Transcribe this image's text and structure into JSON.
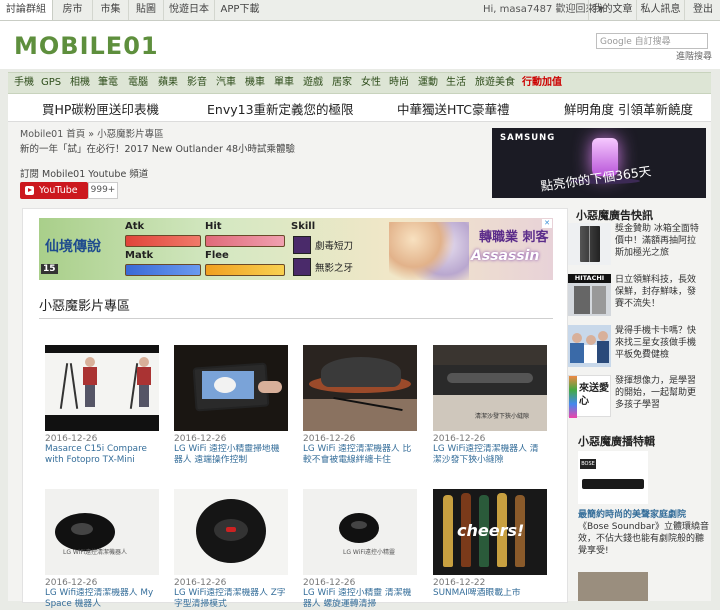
{
  "topbar": {
    "tabs": [
      "討論群組",
      "房市",
      "市集",
      "貼圖",
      "悅遊日本",
      "APP下載"
    ],
    "user_text": "Hi, masa7487 歡迎回來 ▾",
    "links": [
      "我的文章",
      "私人訊息",
      "登出"
    ]
  },
  "header": {
    "logo_text": "MOBILE",
    "logo_num": "01",
    "search_placeholder": "Google 自訂搜尋",
    "search_link": "進階搜尋"
  },
  "nav": {
    "items": [
      "手機",
      "GPS",
      "相機",
      "筆電",
      "電腦",
      "蘋果",
      "影音",
      "汽車",
      "機車",
      "單車",
      "遊戲",
      "居家",
      "女性",
      "時尚",
      "運動",
      "生活",
      "旅遊美食"
    ],
    "hot": "行動加值"
  },
  "promo": {
    "items": [
      "買HP碳粉匣送印表機",
      "Envy13重新定義您的極限",
      "中華獨送HTC豪華禮",
      "鮮明角度 引領革新饒度"
    ]
  },
  "main": {
    "breadcrumb": "Mobile01 首頁 » 小惡魔影片專區",
    "subline": "新的一年「試」在必行！2017 New Outlander 48小時試乘體驗",
    "subscribe_label": "訂閱 Mobile01 Youtube 頻道",
    "youtube_label": "YouTube",
    "youtube_count": "999+"
  },
  "ad_samsung": {
    "brand": "SAMSUNG",
    "slogan": "點亮你的下個365天"
  },
  "banner": {
    "game_title": "仙境傳說",
    "stats": [
      "Atk",
      "Hit",
      "Matk",
      "Flee"
    ],
    "skill_label": "Skill",
    "skills": [
      "劇毒短刀",
      "無影之牙"
    ],
    "job_name": "轉職業 刺客",
    "job_en": "Assassin",
    "level": "15",
    "ad_badge": "✕"
  },
  "videos": {
    "section_title": "小惡魔影片專區",
    "items": [
      {
        "date": "2016-12-26",
        "title": "Masarce C15i Compare with Fotopro TX-Mini"
      },
      {
        "date": "2016-12-26",
        "title": "LG WiFi 遠控小精靈掃地機器人 遠端操作控制"
      },
      {
        "date": "2016-12-26",
        "title": "LG WiFi 遠控清潔機器人 比較不會被電線絆纏卡住"
      },
      {
        "date": "2016-12-26",
        "title": "LG WiFi遠控清潔機器人 清潔沙發下狹小縫隙"
      },
      {
        "date": "2016-12-26",
        "title": "LG Wifi遠控清潔機器人 My Space 機器人"
      },
      {
        "date": "2016-12-26",
        "title": "LG WiFi遠控清潔機器人 Z字字型清掃模式"
      },
      {
        "date": "2016-12-26",
        "title": "LG WiFi 遠控小精靈 清潔機器人 螺旋運轉清掃"
      },
      {
        "date": "2016-12-22",
        "title": "SUNMAI啤酒眼載上市"
      }
    ],
    "thumb_captions": [
      "",
      "",
      "",
      "清潔沙發下狹小縫隙",
      "LG WiFi遠控清潔機器人",
      "",
      "LG WiFi遠控小精靈",
      "cheers!"
    ]
  },
  "side": {
    "ad_title": "小惡魔廣告快訊",
    "ads": [
      {
        "text": "獎金贊助 冰箱全面特價中！滿額再抽阿拉斯加極光之旅"
      },
      {
        "text": "日立領鮮科技，長效保鮮，封存鮮味，發賽不流失！"
      },
      {
        "text": "覺得手機卡卡嗎？快來找三星女孩做手機平板免費健檢"
      },
      {
        "text": "發揮想像力，是學習的開始，一起幫助更多孩子學習"
      }
    ],
    "hitachi": "HITACHI",
    "charity_label": "來送愛心",
    "feature_title": "小惡魔廣播特輯",
    "feature_headline": "最簡約時尚的美聲家庭劇院",
    "feature_text": "《Bose Soundbar》立體環繞音效，不佔大錢也能有劇院般的聽覺享受!"
  },
  "colors": {
    "brand_green": "#5e8f3d",
    "link_blue": "#356e9a",
    "youtube_red": "#cc181e",
    "hot_red": "#cc0000"
  }
}
